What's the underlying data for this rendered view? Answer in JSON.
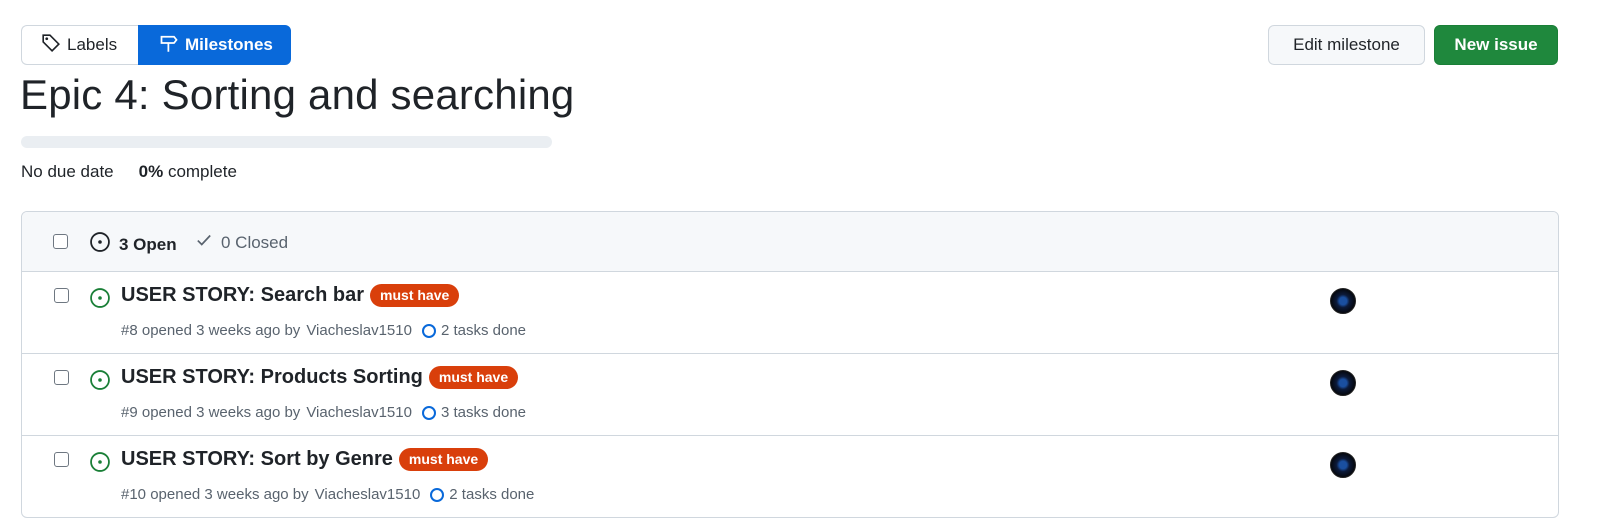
{
  "nav": {
    "labels": "Labels",
    "milestones": "Milestones"
  },
  "actions": {
    "edit_milestone": "Edit milestone",
    "new_issue": "New issue"
  },
  "milestone": {
    "title": "Epic 4: Sorting and searching",
    "due": "No due date",
    "percent": "0%",
    "percent_suffix": " complete",
    "progress_fraction": 0
  },
  "issues_header": {
    "open": "3 Open",
    "closed": "0 Closed"
  },
  "issues": [
    {
      "title": "USER STORY: Search bar",
      "label": "must have",
      "meta": "#8 opened 3 weeks ago by",
      "author": "Viacheslav1510",
      "tasks": "2 tasks done"
    },
    {
      "title": "USER STORY: Products Sorting",
      "label": "must have",
      "meta": "#9 opened 3 weeks ago by",
      "author": "Viacheslav1510",
      "tasks": "3 tasks done"
    },
    {
      "title": "USER STORY: Sort by Genre",
      "label": "must have",
      "meta": "#10 opened 3 weeks ago by",
      "author": "Viacheslav1510",
      "tasks": "2 tasks done"
    }
  ],
  "colors": {
    "primary": "#0969da",
    "success": "#1f883d",
    "label_must_have": "#d93f0b",
    "open_icon": "#1a7f37"
  },
  "icons": {
    "labels": "tag-icon",
    "milestones": "milestone-icon",
    "open": "issue-opened-icon",
    "closed": "check-icon",
    "tasks": "progress-ring-icon"
  }
}
